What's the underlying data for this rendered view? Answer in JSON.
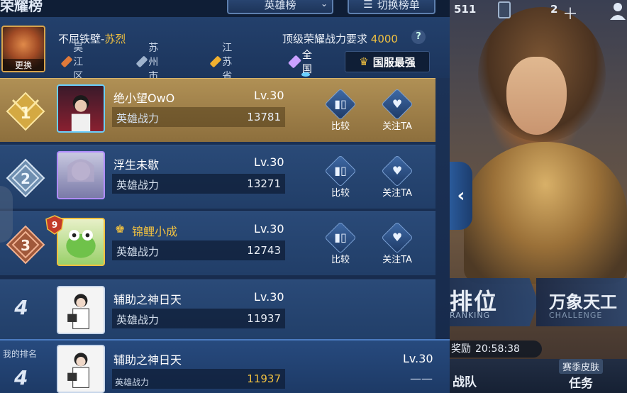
{
  "title": "荣耀榜",
  "dropdown": {
    "label": "英雄榜",
    "icon": "chevron-down-icon"
  },
  "switch_button": {
    "label": "切换榜单",
    "icon": "list-icon"
  },
  "hero": {
    "change_label": "更换",
    "name_prefix": "不屈铁壁-",
    "name_hero": "苏烈"
  },
  "requirement": {
    "label": "顶级荣耀战力要求",
    "value": "4000",
    "help": "?"
  },
  "regions": [
    {
      "label": "吴江区",
      "color": "#e07a3a"
    },
    {
      "label": "苏州市",
      "color": "#9fb3cc"
    },
    {
      "label": "江苏省",
      "color": "#f0b030"
    },
    {
      "label": "全国",
      "color": "#c9a0ff"
    }
  ],
  "national_best": {
    "label": "国服最强"
  },
  "actions": {
    "compare": "比较",
    "follow": "关注TA"
  },
  "power_label": "英雄战力",
  "rows": [
    {
      "rank": "1",
      "name": "绝小望OwO",
      "level": "Lv.30",
      "power": "13781"
    },
    {
      "rank": "2",
      "name": "浮生未歇",
      "level": "Lv.30",
      "power": "13271"
    },
    {
      "rank": "3",
      "name": "锦鲤小成",
      "level": "Lv.30",
      "power": "12743",
      "badge": "9"
    },
    {
      "rank": "4",
      "name": "辅助之神日天",
      "level": "Lv.30",
      "power": "11937"
    }
  ],
  "my_rank": {
    "label": "我的排名",
    "rank": "4",
    "name": "辅助之神日天",
    "level": "Lv.30",
    "power": "11937",
    "dash": "——"
  },
  "scene": {
    "stat_1": "511",
    "stat_2": "2",
    "rank_title": "排位",
    "rank_sub": "RANKING",
    "mode_title": "万象天工",
    "mode_sub": "CHALLENGE",
    "reward_label": "奖励",
    "reward_time": "20:58:38",
    "team": "战队",
    "season_skin": "赛季皮肤",
    "task": "任务"
  }
}
